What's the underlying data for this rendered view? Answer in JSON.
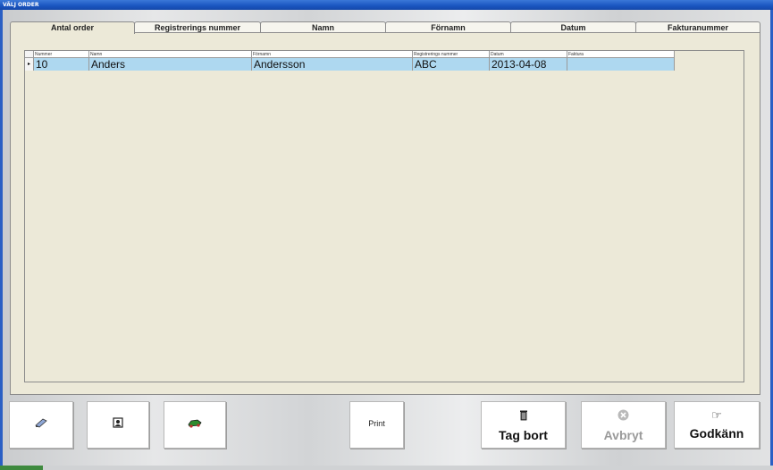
{
  "window": {
    "title": "VÄLJ ORDER"
  },
  "tabs": [
    {
      "label": "Antal order"
    },
    {
      "label": "Registrerings nummer"
    },
    {
      "label": "Namn"
    },
    {
      "label": "Förnamn"
    },
    {
      "label": "Datum"
    },
    {
      "label": "Fakturanummer"
    }
  ],
  "grid": {
    "columns": [
      "Nummer",
      "Namn",
      "Förnamn",
      "Registrerings nummer",
      "Datum",
      "Faktura"
    ],
    "rows": [
      {
        "nummer": "10",
        "namn": "Anders",
        "fornamn": "Andersson",
        "reg": "ABC",
        "datum": "2013-04-08",
        "faktura": ""
      }
    ],
    "row_indicator": "▸"
  },
  "buttons": {
    "edit_icon": "edit-icon",
    "person_icon": "person-icon",
    "car_icon": "car-icon",
    "print_label": "Print",
    "delete_label": "Tag bort",
    "cancel_label": "Avbryt",
    "approve_label": "Godkänn"
  },
  "colors": {
    "selected_row": "#aed8f0",
    "titlebar": "#1a55c0",
    "panel": "#ece9d8"
  }
}
